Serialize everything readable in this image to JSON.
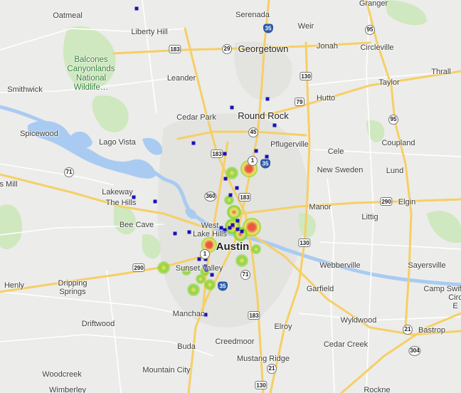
{
  "map": {
    "colors": {
      "land": "#ececea",
      "water": "#a9cbf2",
      "park": "#c8e6b5",
      "highway": "#f6cf65",
      "road": "#ffffff",
      "urban": "#e2e2df",
      "marker": "#1a12b8",
      "heat_green": "#7ed321",
      "heat_yellow": "#f2e35a",
      "heat_red": "#e8412c"
    },
    "places": [
      {
        "name": "Oatmeal",
        "kind": "town"
      },
      {
        "name": "Serenada",
        "kind": "town"
      },
      {
        "name": "Granger",
        "kind": "town"
      },
      {
        "name": "Liberty Hill",
        "kind": "town"
      },
      {
        "name": "Weir",
        "kind": "town"
      },
      {
        "name": "Georgetown",
        "kind": "city"
      },
      {
        "name": "Jonah",
        "kind": "town"
      },
      {
        "name": "Circleville",
        "kind": "town"
      },
      {
        "name": "Balcones\nCanyonlands\nNational\nWildlife…",
        "kind": "park"
      },
      {
        "name": "Thrall",
        "kind": "town"
      },
      {
        "name": "Leander",
        "kind": "town"
      },
      {
        "name": "Taylor",
        "kind": "town"
      },
      {
        "name": "Smithwick",
        "kind": "town"
      },
      {
        "name": "Hutto",
        "kind": "town"
      },
      {
        "name": "Cedar Park",
        "kind": "town"
      },
      {
        "name": "Round Rock",
        "kind": "city"
      },
      {
        "name": "Spicewood",
        "kind": "town"
      },
      {
        "name": "Pflugerville",
        "kind": "town"
      },
      {
        "name": "Lago Vista",
        "kind": "town"
      },
      {
        "name": "Coupland",
        "kind": "town"
      },
      {
        "name": "Cele",
        "kind": "town"
      },
      {
        "name": "New Sweden",
        "kind": "town"
      },
      {
        "name": "Lund",
        "kind": "town"
      },
      {
        "name": "s Mill",
        "kind": "town"
      },
      {
        "name": "Lakeway",
        "kind": "town"
      },
      {
        "name": "The Hills",
        "kind": "town"
      },
      {
        "name": "Manor",
        "kind": "town"
      },
      {
        "name": "Elgin",
        "kind": "town"
      },
      {
        "name": "Littig",
        "kind": "town"
      },
      {
        "name": "Bee Cave",
        "kind": "town"
      },
      {
        "name": "West\nLake Hills",
        "kind": "town"
      },
      {
        "name": "Austin",
        "kind": "metro"
      },
      {
        "name": "Webberville",
        "kind": "town"
      },
      {
        "name": "Sayersville",
        "kind": "town"
      },
      {
        "name": "Sunset Valley",
        "kind": "town"
      },
      {
        "name": "Henly",
        "kind": "town"
      },
      {
        "name": "Dripping\nSprings",
        "kind": "town"
      },
      {
        "name": "Garfield",
        "kind": "town"
      },
      {
        "name": "Camp Swif",
        "kind": "town"
      },
      {
        "name": "Circ\nE",
        "kind": "town"
      },
      {
        "name": "Manchac",
        "kind": "town"
      },
      {
        "name": "Driftwood",
        "kind": "town"
      },
      {
        "name": "Wyldwood",
        "kind": "town"
      },
      {
        "name": "Elroy",
        "kind": "town"
      },
      {
        "name": "Bastrop",
        "kind": "town"
      },
      {
        "name": "Buda",
        "kind": "town"
      },
      {
        "name": "Creedmoor",
        "kind": "town"
      },
      {
        "name": "Cedar Creek",
        "kind": "town"
      },
      {
        "name": "Woodcreek",
        "kind": "town"
      },
      {
        "name": "Mountain City",
        "kind": "town"
      },
      {
        "name": "Mustang Ridge",
        "kind": "town"
      },
      {
        "name": "Wimberley",
        "kind": "town"
      },
      {
        "name": "Rockne",
        "kind": "town"
      }
    ],
    "shields": [
      {
        "label": "35",
        "type": "interstate"
      },
      {
        "label": "183",
        "type": "us"
      },
      {
        "label": "29",
        "type": "state"
      },
      {
        "label": "95",
        "type": "state"
      },
      {
        "label": "130",
        "type": "us"
      },
      {
        "label": "79",
        "type": "us"
      },
      {
        "label": "95",
        "type": "state"
      },
      {
        "label": "45",
        "type": "state"
      },
      {
        "label": "183",
        "type": "us"
      },
      {
        "label": "1",
        "type": "state"
      },
      {
        "label": "35",
        "type": "interstate"
      },
      {
        "label": "71",
        "type": "state"
      },
      {
        "label": "360",
        "type": "state"
      },
      {
        "label": "183",
        "type": "us"
      },
      {
        "label": "290",
        "type": "us"
      },
      {
        "label": "130",
        "type": "us"
      },
      {
        "label": "1",
        "type": "state"
      },
      {
        "label": "290",
        "type": "us"
      },
      {
        "label": "71",
        "type": "state"
      },
      {
        "label": "35",
        "type": "interstate"
      },
      {
        "label": "183",
        "type": "us"
      },
      {
        "label": "21",
        "type": "state"
      },
      {
        "label": "304",
        "type": "state"
      },
      {
        "label": "21",
        "type": "state"
      },
      {
        "label": "130",
        "type": "us"
      }
    ],
    "markers_count": 28,
    "heat_spots": [
      {
        "intensity": "high"
      },
      {
        "intensity": "high"
      },
      {
        "intensity": "medium"
      },
      {
        "intensity": "medium"
      },
      {
        "intensity": "high"
      },
      {
        "intensity": "medium"
      },
      {
        "intensity": "low"
      },
      {
        "intensity": "low"
      },
      {
        "intensity": "low"
      },
      {
        "intensity": "low"
      },
      {
        "intensity": "low"
      },
      {
        "intensity": "low"
      },
      {
        "intensity": "low"
      },
      {
        "intensity": "low"
      },
      {
        "intensity": "low"
      },
      {
        "intensity": "low"
      }
    ]
  }
}
